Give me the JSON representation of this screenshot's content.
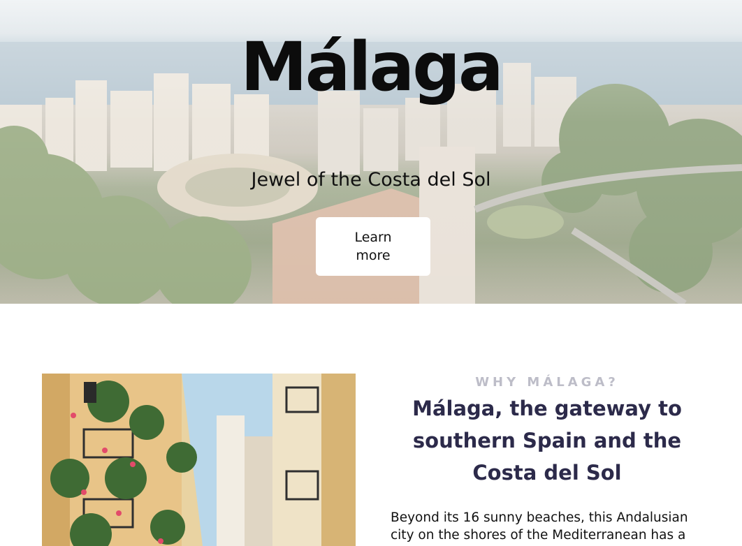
{
  "hero": {
    "title": "Málaga",
    "subtitle": "Jewel of the Costa del Sol",
    "button_label": "Learn more"
  },
  "why": {
    "eyebrow": "WHY MÁLAGA?",
    "heading": "Málaga, the gateway to southern Spain and the Costa del Sol",
    "body": "Beyond its 16 sunny beaches, this Andalusian city on the shores of the Mediterranean has a"
  },
  "colors": {
    "heading": "#2c2a4a",
    "eyebrow": "#bdbdc8",
    "button_bg": "#ffffff"
  }
}
